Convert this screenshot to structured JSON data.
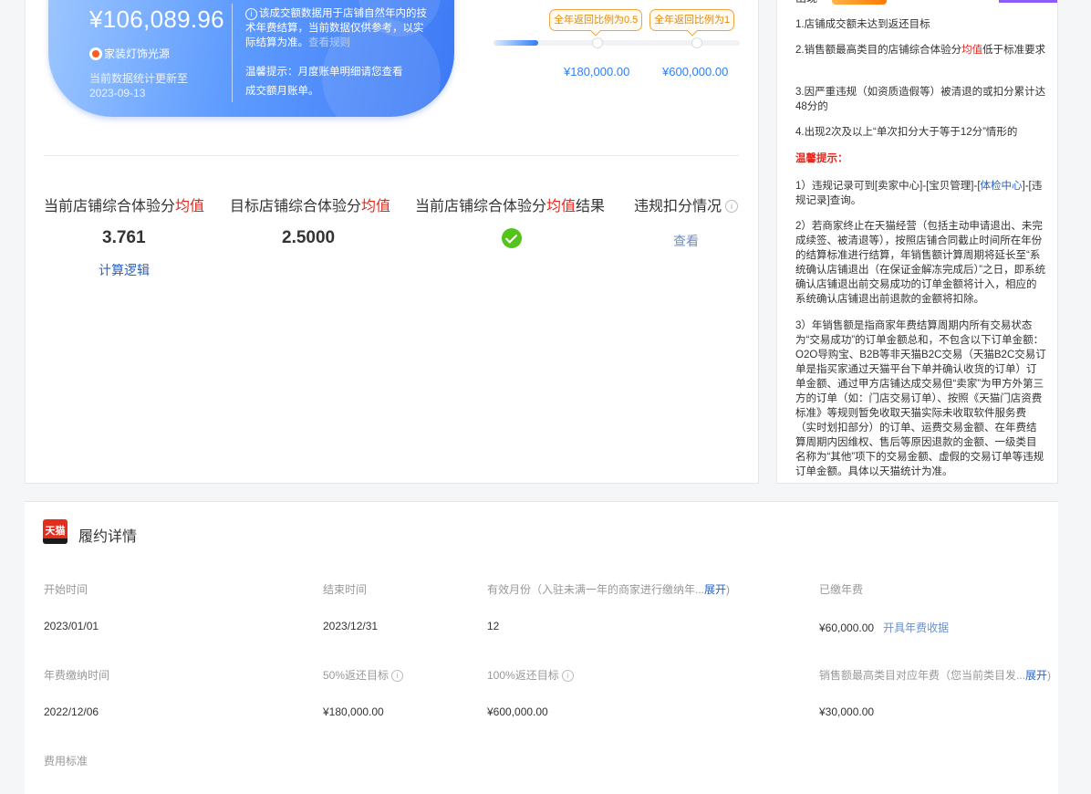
{
  "hero": {
    "amount": "¥106,089.96",
    "category": "家装灯饰光源",
    "update_line1": "当前数据统计更新至",
    "update_date": "2023-09-13",
    "note_text": "该成交额数据用于店铺自然年内的技术年费结算，当前数据仅供参考，以实际结算为准。",
    "note_link": "查看规则",
    "tip": "温馨提示：月度账单明细请您查看成交额月账单。"
  },
  "progress": {
    "badge_half": "全年返回比例为0.5",
    "badge_full": "全年返回比例为1",
    "target_half": "¥180,000.00",
    "target_full": "¥600,000.00",
    "fill_fraction": 0.18
  },
  "stats": {
    "current_score_label_a": "当前店铺综合体验分",
    "current_score_label_b": "均值",
    "current_score": "3.761",
    "calc_link": "计算逻辑",
    "target_score_label_a": "目标店铺综合体验分",
    "target_score_label_b": "均值",
    "target_score": "2.5000",
    "result_label_a": "当前店铺综合体验分",
    "result_label_b": "均值",
    "result_label_c": "结果",
    "violation_label": "违规扣分情况",
    "violation_link": "查看"
  },
  "rules": {
    "top_cut": "出现",
    "item1": "1.店铺成交额未达到返还目标",
    "item2a": "2.销售额最高类目的店铺综合体验分",
    "item2b": "均值",
    "item2c": "低于标准要求",
    "item3": "3.因严重违规（如资质造假等）被清退的或扣分累计达48分的",
    "item4": "4.出现2次及以上“单次扣分大于等于12分”情形的",
    "warm_title": "温馨提示：",
    "tip1a": "1）违规记录可到[卖家中心]-[宝贝管理]-[",
    "tip1b": "体检中心",
    "tip1c": "]-[违规记录]查询。",
    "tip2": "2）若商家终止在天猫经营（包括主动申请退出、未完成续签、被清退等），按照店铺合同截止时间所在年份的结算标准进行结算，年销售额计算周期将延长至“系统确认店铺退出（在保证金解冻完成后）”之日，即系统确认店铺退出前交易成功的订单金额将计入，相应的系统确认店铺退出前退款的金额将扣除。",
    "tip3": "3）年销售额是指商家年费结算周期内所有交易状态为“交易成功”的订单金额总和，不包含以下订单金额：O2O导购宝、B2B等非天猫B2C交易（天猫B2C交易订单是指买家通过天猫平台下单并确认收货的订单）订单金额、通过甲方店铺达成交易但“卖家”为甲方外第三方的订单（如：门店交易订单）、按照《天猫门店资费标准》等规则暂免收取天猫实际未收取软件服务费（实时划扣部分）的订单、运费交易金额、在年费结算周期内因维权、售后等原因退款的金额、一级类目名称为“其他”项下的交易金额、虚假的交易订单等违规订单金额。具体以天猫统计为准。"
  },
  "fulfillment": {
    "logo_text": "天猫",
    "title": "履约详情",
    "start_label": "开始时间",
    "start_value": "2023/01/01",
    "end_label": "结束时间",
    "end_value": "2023/12/31",
    "months_label": "有效月份（入驻未满一年的商家进行缴纳年...",
    "expand": "展开",
    "months_value": "12",
    "paid_label": "已缴年费",
    "paid_value": "¥60,000.00",
    "invoice_link": "开具年费收据",
    "paytime_label": "年费缴纳时间",
    "paytime_value": "2022/12/06",
    "half_label": "50%返还目标",
    "half_value": "¥180,000.00",
    "full_label": "100%返还目标",
    "full_value": "¥600,000.00",
    "topcat_label": "销售额最高类目对应年费（您当前类目发...",
    "topcat_value": "¥30,000.00",
    "fee_std_label": "费用标准"
  }
}
